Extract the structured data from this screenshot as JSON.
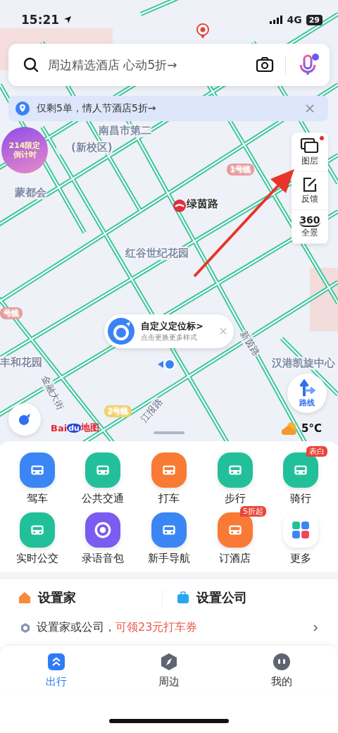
{
  "status_bar": {
    "time": "15:21",
    "network": "4G",
    "battery": "29"
  },
  "search": {
    "placeholder": "周边精选酒店 心动5折→"
  },
  "banner": {
    "text": "仅剩5单，情人节酒店5折→"
  },
  "promo_badge": {
    "line1": "214限定",
    "line2": "倒计时"
  },
  "map_labels": [
    {
      "text": "南昌市第二",
      "kind": "place"
    },
    {
      "text": "(新校区)",
      "kind": "place"
    },
    {
      "text": "蒙都会",
      "kind": "place"
    },
    {
      "text": "1号线",
      "kind": "metro"
    },
    {
      "text": "绿茵路",
      "kind": "station"
    },
    {
      "text": "红谷世纪花园",
      "kind": "place"
    },
    {
      "text": "号线",
      "kind": "metro"
    },
    {
      "text": "丰和花园",
      "kind": "place"
    },
    {
      "text": "金融大街",
      "kind": "road"
    },
    {
      "text": "汉港凯旋中心",
      "kind": "place"
    },
    {
      "text": "2号线",
      "kind": "metro2"
    },
    {
      "text": "江报路",
      "kind": "road"
    },
    {
      "text": "新茵路",
      "kind": "road"
    }
  ],
  "map_tools": [
    {
      "label": "图层",
      "new": true
    },
    {
      "label": "反馈",
      "new": false
    },
    {
      "label": "全景",
      "icon_text": "360",
      "new": false
    }
  ],
  "location_tip": {
    "title": "自定义定位标>",
    "subtitle": "点击更换更多样式"
  },
  "route_button": {
    "label": "路线"
  },
  "logo": {
    "part1": "Bai",
    "part2": "du",
    "part3": "地图"
  },
  "weather": {
    "temp": "5°C"
  },
  "services": [
    {
      "label": "驾车",
      "kind": "service",
      "color": "#3a86f5"
    },
    {
      "label": "公共交通",
      "kind": "service",
      "color": "#22c09a"
    },
    {
      "label": "打车",
      "kind": "service",
      "color": "#f97a34"
    },
    {
      "label": "步行",
      "kind": "service",
      "color": "#22c09a"
    },
    {
      "label": "骑行",
      "kind": "service",
      "color": "#22c09a",
      "badge": "表白"
    },
    {
      "label": "实时公交",
      "kind": "service",
      "color": "#22c09a"
    },
    {
      "label": "录语音包",
      "kind": "service",
      "color": "#7a5cf0"
    },
    {
      "label": "新手导航",
      "kind": "service",
      "color": "#3a86f5"
    },
    {
      "label": "订酒店",
      "kind": "service",
      "color": "#f97a34",
      "badge": "5折起"
    },
    {
      "label": "更多",
      "kind": "more",
      "color": "#ffffff"
    }
  ],
  "places": [
    {
      "label": "设置家",
      "kind": "home"
    },
    {
      "label": "设置公司",
      "kind": "work"
    }
  ],
  "promo": {
    "text": "设置家或公司，",
    "highlight": "可领23元打车券"
  },
  "tabs": [
    {
      "label": "出行",
      "selected": true
    },
    {
      "label": "周边",
      "selected": false
    },
    {
      "label": "我的",
      "selected": false
    }
  ]
}
